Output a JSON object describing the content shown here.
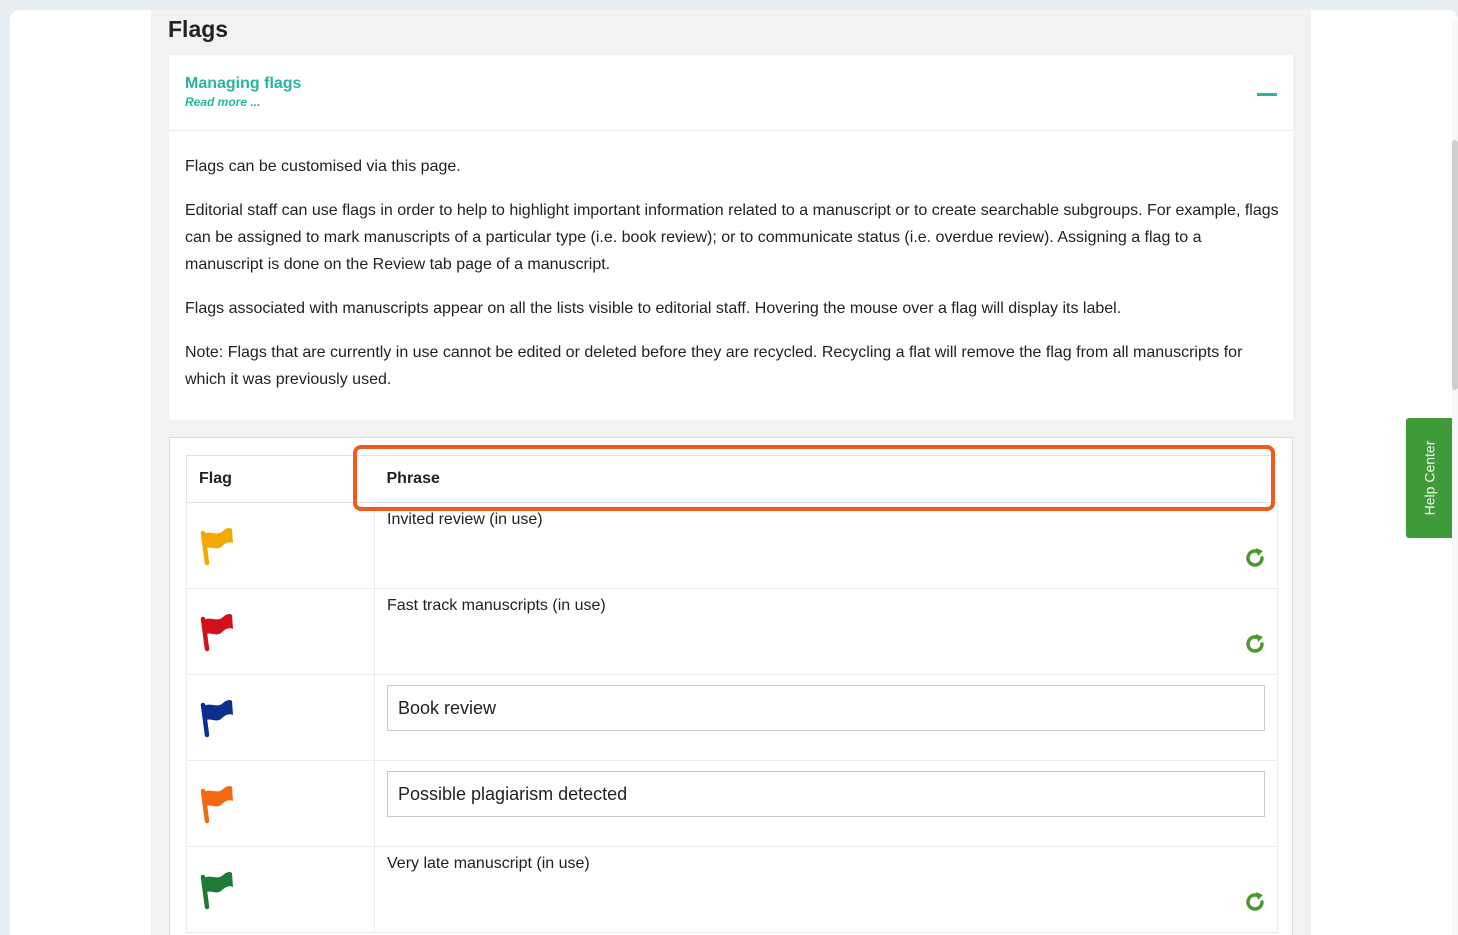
{
  "page": {
    "title": "Flags"
  },
  "info": {
    "link": "Managing flags",
    "read_more": "Read more ...",
    "paragraphs": [
      "Flags can be customised via this page.",
      "Editorial staff can use flags in order to help to highlight important information related to a manuscript or to create searchable subgroups. For example, flags can be assigned to mark manuscripts of a particular type (i.e. book review); or to communicate status (i.e. overdue review). Assigning a flag to a manuscript is done on the Review tab page of a manuscript.",
      "Flags associated with manuscripts appear on all the lists visible to editorial staff. Hovering the mouse over a flag will display its label.",
      "Note: Flags that are currently in use cannot be edited or deleted before they are recycled. Recycling a flat will remove the flag from all manuscripts for which it was previously used."
    ]
  },
  "table": {
    "headers": {
      "flag": "Flag",
      "phrase": "Phrase"
    },
    "rows": [
      {
        "flag_color": "#f2a900",
        "icon": "flag-yellow-icon",
        "phrase": "Invited review (in use)",
        "editable": false
      },
      {
        "flag_color": "#d0111b",
        "icon": "flag-red-icon",
        "phrase": "Fast track manuscripts (in use)",
        "editable": false
      },
      {
        "flag_color": "#0b2f8f",
        "icon": "flag-blue-icon",
        "phrase": "Book review",
        "editable": true
      },
      {
        "flag_color": "#f06a12",
        "icon": "flag-orange-icon",
        "phrase": "Possible plagiarism detected",
        "editable": true
      },
      {
        "flag_color": "#1f7a35",
        "icon": "flag-green-icon",
        "phrase": "Very late manuscript (in use)",
        "editable": false
      }
    ]
  },
  "help_center": {
    "label": "Help Center"
  },
  "colors": {
    "accent": "#27b5a0",
    "recycle": "#4a9a2f",
    "highlight": "#f05a1a",
    "help_tab": "#3f9a3a"
  }
}
